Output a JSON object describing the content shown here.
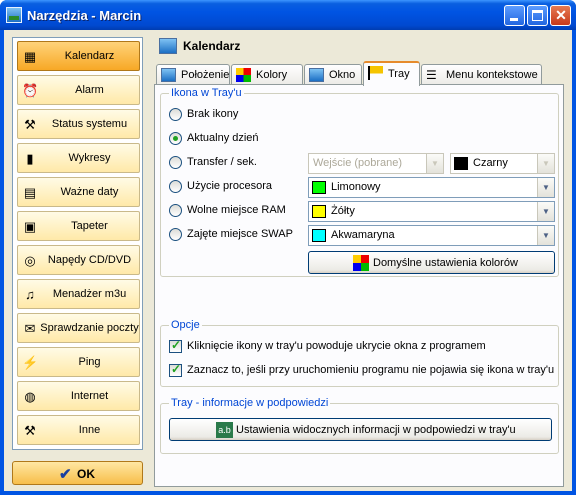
{
  "window": {
    "title": "Narzędzia - Marcin"
  },
  "nav": {
    "items": [
      {
        "label": "Kalendarz",
        "icon": "calendar-icon",
        "glyph": "▦"
      },
      {
        "label": "Alarm",
        "icon": "alarm-clock-icon",
        "glyph": "⏰"
      },
      {
        "label": "Status systemu",
        "icon": "tools-icon",
        "glyph": "⚒"
      },
      {
        "label": "Wykresy",
        "icon": "bar-chart-icon",
        "glyph": "▮"
      },
      {
        "label": "Ważne daty",
        "icon": "date-table-icon",
        "glyph": "▤"
      },
      {
        "label": "Tapeter",
        "icon": "monitor-icon",
        "glyph": "▣"
      },
      {
        "label": "Napędy CD/DVD",
        "icon": "cd-icon",
        "glyph": "◎"
      },
      {
        "label": "Menadżer m3u",
        "icon": "music-file-icon",
        "glyph": "♫"
      },
      {
        "label": "Sprawdzanie poczty",
        "icon": "envelope-icon",
        "glyph": "✉"
      },
      {
        "label": "Ping",
        "icon": "plug-icon",
        "glyph": "⚡"
      },
      {
        "label": "Internet",
        "icon": "globe-icon",
        "glyph": "◍"
      },
      {
        "label": "Inne",
        "icon": "hammer-icon",
        "glyph": "⚒"
      }
    ],
    "ok_label": "OK"
  },
  "header": {
    "title": "Kalendarz"
  },
  "tabs": [
    {
      "label": "Położenie",
      "icon": "calendar-icon"
    },
    {
      "label": "Kolory",
      "icon": "color-grid-icon"
    },
    {
      "label": "Okno",
      "icon": "window-icon"
    },
    {
      "label": "Tray",
      "icon": "tray-flag-icon"
    },
    {
      "label": "Menu kontekstowe",
      "icon": "list-icon"
    }
  ],
  "tray_icon": {
    "legend": "Ikona w Tray'u",
    "options": [
      "Brak ikony",
      "Aktualny dzień",
      "Transfer / sek.",
      "Użycie procesora",
      "Wolne miejsce RAM",
      "Zajęte miejsce SWAP"
    ],
    "transfer_source": "Wejście (pobrane)",
    "colors": [
      {
        "name": "Czarny",
        "hex": "#000000"
      },
      {
        "name": "Limonowy",
        "hex": "#00ff00"
      },
      {
        "name": "Żółty",
        "hex": "#ffff00"
      },
      {
        "name": "Akwamaryna",
        "hex": "#00ffff"
      }
    ],
    "default_colors_button": "Domyślne ustawienia kolorów"
  },
  "options": {
    "legend": "Opcje",
    "items": [
      "Kliknięcie ikony w tray'u powoduje ukrycie okna z programem",
      "Zaznacz to, jeśli przy uruchomieniu programu nie pojawia się ikona w tray'u"
    ]
  },
  "tooltip": {
    "legend": "Tray - informacje w podpowiedzi",
    "button": "Ustawienia widocznych informacji w podpowiedzi w tray'u"
  }
}
